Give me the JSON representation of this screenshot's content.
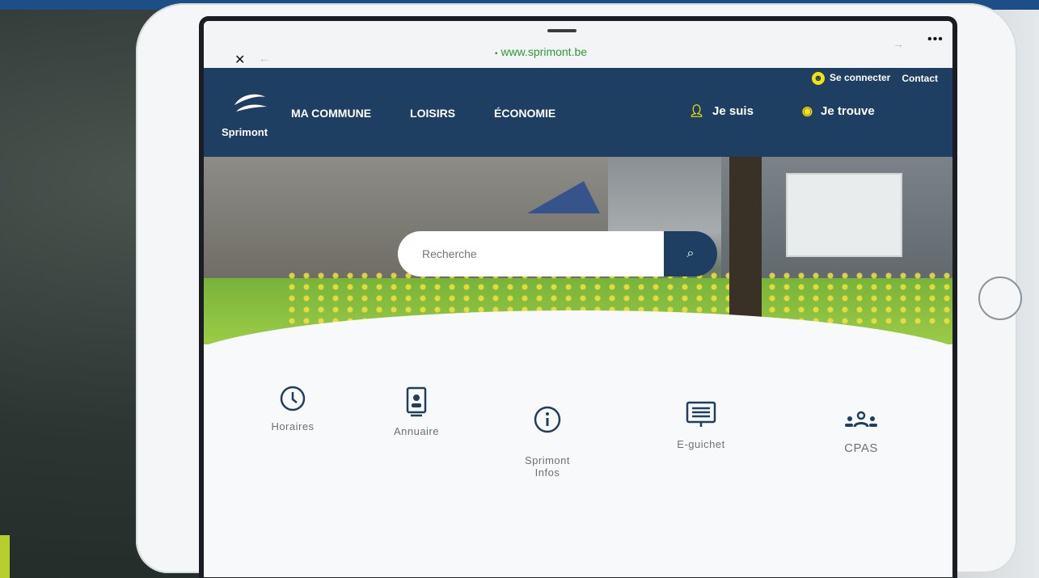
{
  "browser": {
    "url": "www.sprimont.be",
    "close_label": "✕",
    "back_label": "←",
    "forward_label": "→",
    "more_label": "•••"
  },
  "header": {
    "top_links": [
      "Se connecter",
      "Contact"
    ],
    "logo_text": "Sprimont",
    "nav": [
      "MA COMMUNE",
      "LOISIRS",
      "ÉCONOMIE"
    ],
    "actions": [
      {
        "label": "Je suis",
        "icon": "user-icon"
      },
      {
        "label": "Je trouve",
        "icon": "eye-icon"
      }
    ]
  },
  "search": {
    "placeholder": "Recherche",
    "button_icon": "search-icon"
  },
  "tiles": [
    {
      "label": "Horaires",
      "icon": "clock-icon"
    },
    {
      "label": "Annuaire",
      "icon": "contact-card-icon"
    },
    {
      "label": "Sprimont\nInfos",
      "icon": "info-icon"
    },
    {
      "label": "E-guichet",
      "icon": "screen-list-icon"
    },
    {
      "label": "CPAS",
      "icon": "group-icon"
    }
  ],
  "colors": {
    "brand_blue": "#1e3e62",
    "accent_yellow": "#f3e20b",
    "top_band": "#1d4f86"
  }
}
